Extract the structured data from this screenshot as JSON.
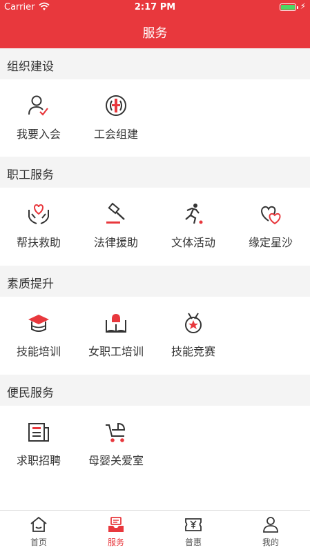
{
  "status_bar": {
    "carrier": "Carrier",
    "time": "2:17 PM"
  },
  "header": {
    "title": "服务"
  },
  "sections": [
    {
      "title": "组织建设",
      "items": [
        {
          "label": "我要入会",
          "icon": "user-check-icon"
        },
        {
          "label": "工会组建",
          "icon": "union-emblem-icon"
        }
      ]
    },
    {
      "title": "职工服务",
      "items": [
        {
          "label": "帮扶救助",
          "icon": "hands-heart-icon"
        },
        {
          "label": "法律援助",
          "icon": "gavel-icon"
        },
        {
          "label": "文体活动",
          "icon": "runner-icon"
        },
        {
          "label": "缘定星沙",
          "icon": "double-heart-icon"
        }
      ]
    },
    {
      "title": "素质提升",
      "items": [
        {
          "label": "技能培训",
          "icon": "graduation-cap-icon"
        },
        {
          "label": "女职工培训",
          "icon": "book-bell-icon"
        },
        {
          "label": "技能竞赛",
          "icon": "medal-icon"
        }
      ]
    },
    {
      "title": "便民服务",
      "items": [
        {
          "label": "求职招聘",
          "icon": "newspaper-icon"
        },
        {
          "label": "母婴关爱室",
          "icon": "stroller-icon"
        }
      ]
    }
  ],
  "tabbar": {
    "tabs": [
      {
        "label": "首页",
        "icon": "home-icon"
      },
      {
        "label": "服务",
        "icon": "service-icon",
        "active": true
      },
      {
        "label": "普惠",
        "icon": "yuan-icon"
      },
      {
        "label": "我的",
        "icon": "profile-icon"
      }
    ]
  },
  "colors": {
    "accent": "#e8383d",
    "icon_stroke": "#333333",
    "section_bg": "#f4f4f4"
  }
}
